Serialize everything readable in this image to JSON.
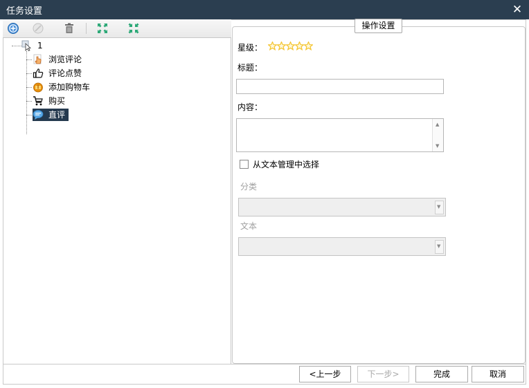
{
  "window": {
    "title": "任务设置",
    "close_glyph": "✕"
  },
  "toolbar": {
    "items": [
      {
        "name": "add-icon"
      },
      {
        "name": "remove-icon"
      },
      {
        "name": "delete-icon"
      },
      {
        "name": "expand-all-icon"
      },
      {
        "name": "collapse-all-icon"
      }
    ]
  },
  "tree": {
    "root": {
      "label": "1",
      "icon": "cursor-icon"
    },
    "children": [
      {
        "label": "浏览评论",
        "icon": "hand-pointer-icon",
        "selected": false
      },
      {
        "label": "评论点赞",
        "icon": "thumbs-up-icon",
        "selected": false
      },
      {
        "label": "添加购物车",
        "icon": "cart-add-icon",
        "selected": false
      },
      {
        "label": "购买",
        "icon": "shopping-cart-icon",
        "selected": false
      },
      {
        "label": "直评",
        "icon": "speech-bubble-icon",
        "selected": true
      }
    ]
  },
  "settings": {
    "group_title": "操作设置",
    "rating_label": "星级：",
    "rating": 5,
    "rating_max": 5,
    "title_label": "标题：",
    "title_value": "",
    "content_label": "内容：",
    "content_value": "",
    "checkbox_label": "从文本管理中选择",
    "checkbox_checked": false,
    "category_label": "分类",
    "category_value": "",
    "text_label": "文本",
    "text_value": ""
  },
  "footer": {
    "prev_label": "<上一步",
    "next_label": "下一步>",
    "finish_label": "完成",
    "cancel_label": "取消"
  },
  "colors": {
    "titlebar": "#2b3e50",
    "selected": "#253a4f",
    "star": "#f4c430",
    "accent_green": "#2aa876",
    "accent_blue": "#3a8fd6"
  }
}
